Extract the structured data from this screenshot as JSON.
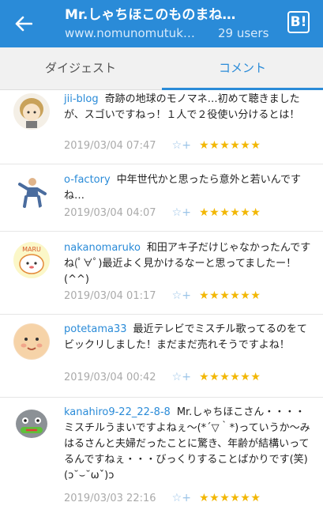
{
  "appbar": {
    "title": "Mr.しゃちほこのものまね…",
    "subtitle": "www.nomunomutuk…",
    "users": "29 users",
    "hatena_button": "B!"
  },
  "tabs": [
    {
      "label": "ダイジェスト",
      "active": false
    },
    {
      "label": "コメント",
      "active": true
    }
  ],
  "accent_color": "#2a8bd8",
  "star_color": "#f2b705",
  "comments": [
    {
      "user": "jii-blog",
      "text": "奇跡の地球のモノマネ…初めて聴きましたが、スゴいですねっ！１人で２役使い分けるとは！",
      "date": "2019/03/04 07:47",
      "stars": "★★★★★★"
    },
    {
      "user": "o-factory",
      "text": "中年世代かと思ったら意外と若いんですね…",
      "date": "2019/03/04 04:07",
      "stars": "★★★★★★"
    },
    {
      "user": "nakanomaruko",
      "text": "和田アキ子だけじゃなかったんですね(ﾟ∀ﾟ)最近よく見かけるなーと思ってましたー！(^^)",
      "date": "2019/03/04 01:17",
      "stars": "★★★★★★"
    },
    {
      "user": "potetama33",
      "text": "最近テレビでミスチル歌ってるのをてビックリしました！まだまだ売れそうですよね！",
      "date": "2019/03/04 00:42",
      "stars": "★★★★★★"
    },
    {
      "user": "kanahiro9-22_22-8-8",
      "text": "Mr.しゃちほこさん・・・・ミスチルうまいですよねぇ〜(*´▽｀*)っていうか〜みはるさんと夫婦だったことに驚き、年齢が結構いってるんですねぇ・・・びっくりすることばかりです(笑)(ɔ˘⌣˘ωˇ)ɔ",
      "date": "2019/03/03 22:16",
      "stars": "★★★★★★"
    }
  ],
  "star_add_icon": "☆+"
}
